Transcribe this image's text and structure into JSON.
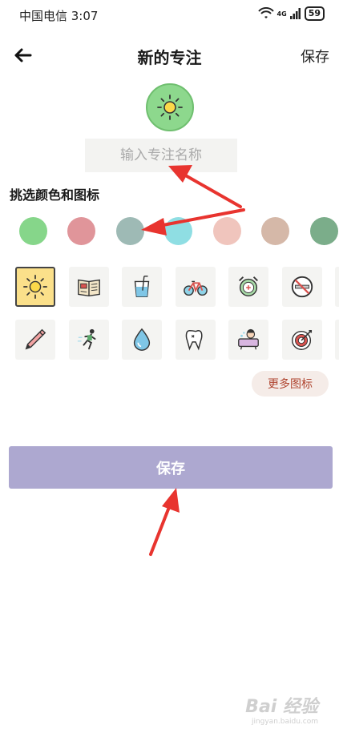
{
  "status_bar": {
    "carrier": "中国电信 3:07",
    "network": "4G",
    "battery": "59"
  },
  "header": {
    "title": "新的专注",
    "save_label": "保存"
  },
  "name_input": {
    "placeholder": "输入专注名称"
  },
  "section_label": "挑选颜色和图标",
  "colors": [
    "#86d68a",
    "#e0959a",
    "#9ebab5",
    "#8fdee3",
    "#f0c5bd",
    "#d5b8a8",
    "#7bad8a"
  ],
  "icons": {
    "row1": [
      "sun-icon",
      "book-icon",
      "drink-icon",
      "bicycle-icon",
      "alarm-clock-icon",
      "no-smoking-icon"
    ],
    "row2": [
      "pencil-icon",
      "runner-icon",
      "water-drop-icon",
      "tooth-icon",
      "bathtub-icon",
      "target-icon"
    ],
    "selected": "sun-icon"
  },
  "more_icons_label": "更多图标",
  "save_button_label": "保存",
  "watermark": {
    "main": "Bai 经验",
    "sub": "jingyan.baidu.com"
  }
}
